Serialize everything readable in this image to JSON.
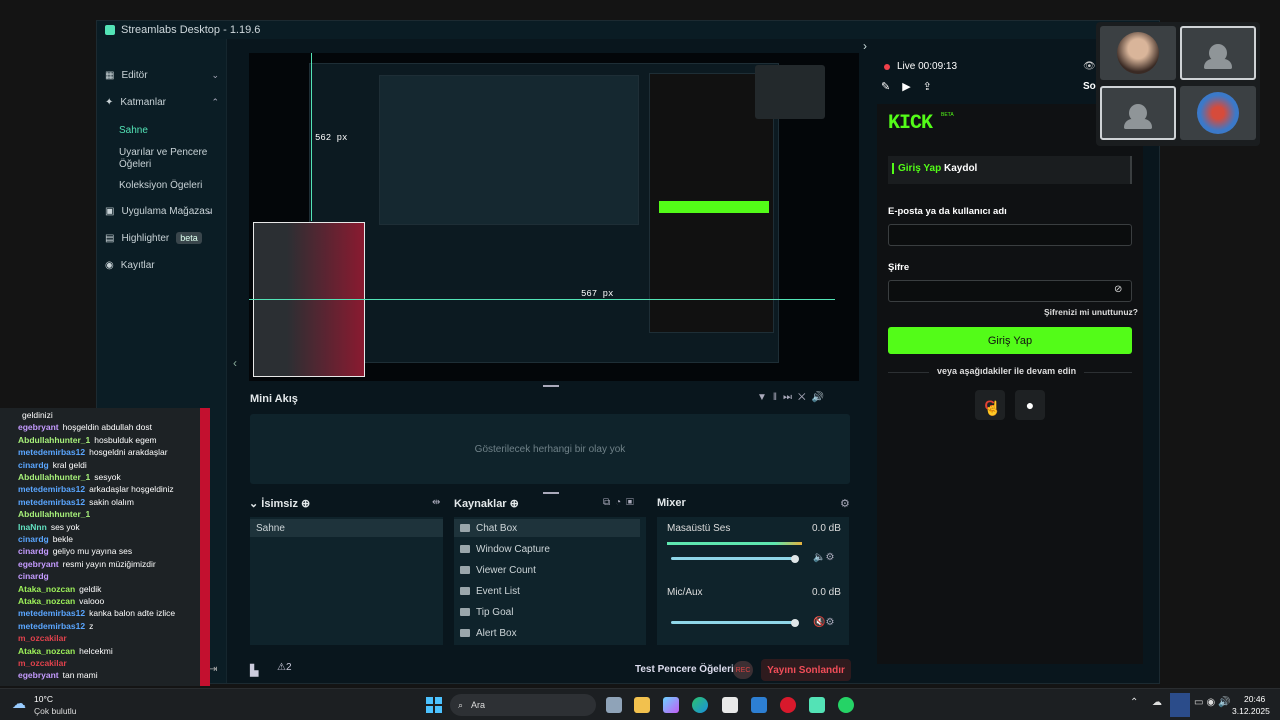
{
  "window": {
    "title": "Streamlabs Desktop - 1.19.6"
  },
  "sidebar": {
    "items": [
      {
        "label": "Editör",
        "icon": "grid-icon"
      },
      {
        "label": "Katmanlar",
        "icon": "layers-icon"
      },
      {
        "label": "Uygulama Mağazası",
        "icon": "store-icon"
      },
      {
        "label": "Highlighter",
        "badge": "beta",
        "icon": "highlighter-icon"
      },
      {
        "label": "Kayıtlar",
        "icon": "recordings-icon"
      }
    ],
    "subitems": [
      "Sahne",
      "Uyarılar ve Pencere Öğeleri",
      "Koleksiyon Ögeleri"
    ]
  },
  "preview": {
    "measure_top": "562 px",
    "measure_right": "567 px"
  },
  "mini_feed": {
    "title": "Mini Akış",
    "empty": "Gösterilecek herhangi bir olay yok"
  },
  "scenes": {
    "title": "İsimsiz",
    "items": [
      "Sahne"
    ]
  },
  "sources": {
    "title": "Kaynaklar",
    "items": [
      "Chat Box",
      "Window Capture",
      "Viewer Count",
      "Event List",
      "Tip Goal",
      "Alert Box"
    ]
  },
  "mixer": {
    "title": "Mixer",
    "channels": [
      {
        "name": "Masaüstü Ses",
        "db": "0.0 dB"
      },
      {
        "name": "Mic/Aux",
        "db": "0.0 dB"
      }
    ]
  },
  "footer": {
    "test_label": "Test Pencere Öğeleri",
    "rec": "REC",
    "end_stream": "Yayını Sonlandır",
    "notif_count": "2"
  },
  "live": {
    "status": "Live 00:09:13",
    "sol": "Sol"
  },
  "kick": {
    "logo": "KICK",
    "beta": "BETA",
    "tab_login": "Giriş Yap",
    "tab_signup": "Kaydol",
    "email_label": "E-posta ya da kullanıcı adı",
    "password_label": "Şifre",
    "forgot": "Şifrenizi mi unuttunuz?",
    "login_button": "Giriş Yap",
    "or_continue": "veya aşağıdakiler ile devam edin"
  },
  "chat": [
    {
      "user": "",
      "msg": "geldinizi",
      "color": "#ffffff"
    },
    {
      "user": "egebryant",
      "msg": "hoşgeldin abdullah dost",
      "color": "#c49bff"
    },
    {
      "user": "Abdullahhunter_1",
      "msg": "hosbulduk egem",
      "color": "#a7f07a"
    },
    {
      "user": "metedemirbas12",
      "msg": "hosgeldni arakdaşlar",
      "color": "#5aa6ff"
    },
    {
      "user": "cinardg",
      "msg": "kral geldi",
      "color": "#5aa6ff"
    },
    {
      "user": "Abdullahhunter_1",
      "msg": "sesyok",
      "color": "#a7f07a"
    },
    {
      "user": "metedemirbas12",
      "msg": "arkadaşlar hoşgeldiniz",
      "color": "#5aa6ff"
    },
    {
      "user": "metedemirbas12",
      "msg": "sakin olalım",
      "color": "#5aa6ff"
    },
    {
      "user": "Abdullahhunter_1",
      "msg": "",
      "color": "#a7f07a"
    },
    {
      "user": "InaNnn",
      "msg": "ses yok",
      "color": "#62e0c0"
    },
    {
      "user": "cinardg",
      "msg": "bekle",
      "color": "#5aa6ff"
    },
    {
      "user": "cinardg",
      "msg": "geliyo mu yayına ses",
      "color": "#c49bff"
    },
    {
      "user": "egebryant",
      "msg": "resmi yayın müziğimizdir",
      "color": "#c49bff"
    },
    {
      "user": "cinardg",
      "msg": "",
      "color": "#c49bff"
    },
    {
      "user": "Ataka_nozcan",
      "msg": "geldik",
      "color": "#9ef25a"
    },
    {
      "user": "Ataka_nozcan",
      "msg": "valooo",
      "color": "#9ef25a"
    },
    {
      "user": "metedemirbas12",
      "msg": "kanka balon adte izlice",
      "color": "#5aa6ff"
    },
    {
      "user": "metedemirbas12",
      "msg": "z",
      "color": "#5aa6ff"
    },
    {
      "user": "m_ozcakilar",
      "msg": "",
      "color": "#e0424c"
    },
    {
      "user": "Ataka_nozcan",
      "msg": "helcekmi",
      "color": "#9ef25a"
    },
    {
      "user": "m_ozcakilar",
      "msg": "",
      "color": "#e0424c"
    },
    {
      "user": "egebryant",
      "msg": "tan mami",
      "color": "#c49bff"
    }
  ],
  "weather": {
    "temp": "10°C",
    "desc": "Çok bulutlu"
  },
  "taskbar": {
    "search": "Ara",
    "time": "20:46",
    "date": "3.12.2025"
  }
}
